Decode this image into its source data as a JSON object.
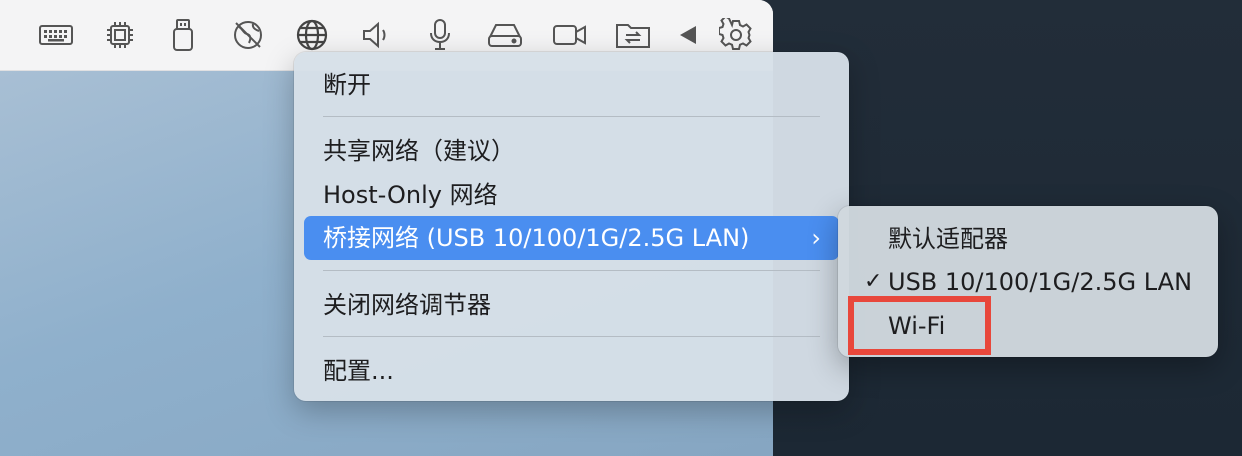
{
  "toolbar": {
    "icons": [
      "keyboard-icon",
      "cpu-icon",
      "usb-drive-icon",
      "network-disabled-icon",
      "globe-icon",
      "speaker-icon",
      "microphone-icon",
      "disk-drive-icon",
      "camera-icon",
      "shared-folder-icon",
      "play-arrow-icon",
      "gear-icon"
    ]
  },
  "menu": {
    "disconnect": "断开",
    "shared_network": "共享网络（建议）",
    "host_only": "Host-Only 网络",
    "bridged": "桥接网络 (USB 10/100/1G/2.5G LAN)",
    "bridged_chevron": "›",
    "close_conditioner": "关闭网络调节器",
    "configure": "配置..."
  },
  "submenu": {
    "default_adapter": "默认适配器",
    "usb_lan": "USB 10/100/1G/2.5G LAN",
    "usb_lan_check": "✓",
    "wifi": "Wi-Fi"
  },
  "colors": {
    "highlight": "#4a8ef0",
    "annotation_box": "#e8473b"
  }
}
